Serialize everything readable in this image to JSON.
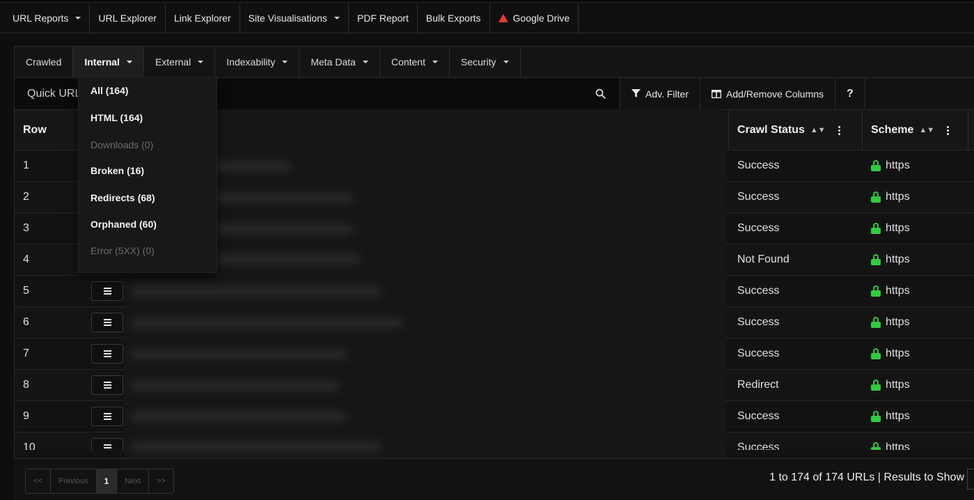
{
  "topnav": {
    "items": [
      {
        "label": "URL Reports",
        "caret": true
      },
      {
        "label": "URL Explorer",
        "caret": false
      },
      {
        "label": "Link Explorer",
        "caret": false
      },
      {
        "label": "Site Visualisations",
        "caret": true
      },
      {
        "label": "PDF Report",
        "caret": false
      },
      {
        "label": "Bulk Exports",
        "caret": false
      },
      {
        "label": "Google Drive",
        "caret": false,
        "icon": "google-drive-icon"
      }
    ]
  },
  "subtabs": {
    "items": [
      {
        "label": "Crawled",
        "caret": false,
        "active": false
      },
      {
        "label": "Internal",
        "caret": true,
        "active": true
      },
      {
        "label": "External",
        "caret": true,
        "active": false
      },
      {
        "label": "Indexability",
        "caret": true,
        "active": false
      },
      {
        "label": "Meta Data",
        "caret": true,
        "active": false
      },
      {
        "label": "Content",
        "caret": true,
        "active": false
      },
      {
        "label": "Security",
        "caret": true,
        "active": false
      }
    ]
  },
  "search": {
    "placeholder": "Quick URL Search",
    "adv_filter": "Adv. Filter",
    "add_remove_columns": "Add/Remove Columns",
    "help": "?"
  },
  "table": {
    "headers": {
      "row": "Row",
      "crawl_status": "Crawl Status",
      "scheme": "Scheme"
    },
    "rows": [
      {
        "row": "1",
        "status": "Success",
        "scheme": "https"
      },
      {
        "row": "2",
        "status": "Success",
        "scheme": "https"
      },
      {
        "row": "3",
        "status": "Success",
        "scheme": "https"
      },
      {
        "row": "4",
        "status": "Not Found",
        "scheme": "https"
      },
      {
        "row": "5",
        "status": "Success",
        "scheme": "https"
      },
      {
        "row": "6",
        "status": "Success",
        "scheme": "https"
      },
      {
        "row": "7",
        "status": "Success",
        "scheme": "https"
      },
      {
        "row": "8",
        "status": "Redirect",
        "scheme": "https"
      },
      {
        "row": "9",
        "status": "Success",
        "scheme": "https"
      },
      {
        "row": "10",
        "status": "Success",
        "scheme": "https"
      }
    ]
  },
  "dropdown": {
    "items": [
      {
        "label": "All (164)",
        "disabled": false
      },
      {
        "label": "HTML (164)",
        "disabled": false
      },
      {
        "label": "Downloads (0)",
        "disabled": true
      },
      {
        "label": "Broken (16)",
        "disabled": false
      },
      {
        "label": "Redirects (68)",
        "disabled": false
      },
      {
        "label": "Orphaned (60)",
        "disabled": false
      },
      {
        "label": "Error (5XX) (0)",
        "disabled": true
      }
    ]
  },
  "pagination": {
    "first": "<<",
    "previous": "Previous",
    "current": "1",
    "next": "Next",
    "last": ">>"
  },
  "footer": {
    "results_text": "1 to 174 of 174 URLs | Results to Show"
  },
  "colors": {
    "accent_green": "#2ecc40",
    "google_drive_red": "#e53935"
  }
}
